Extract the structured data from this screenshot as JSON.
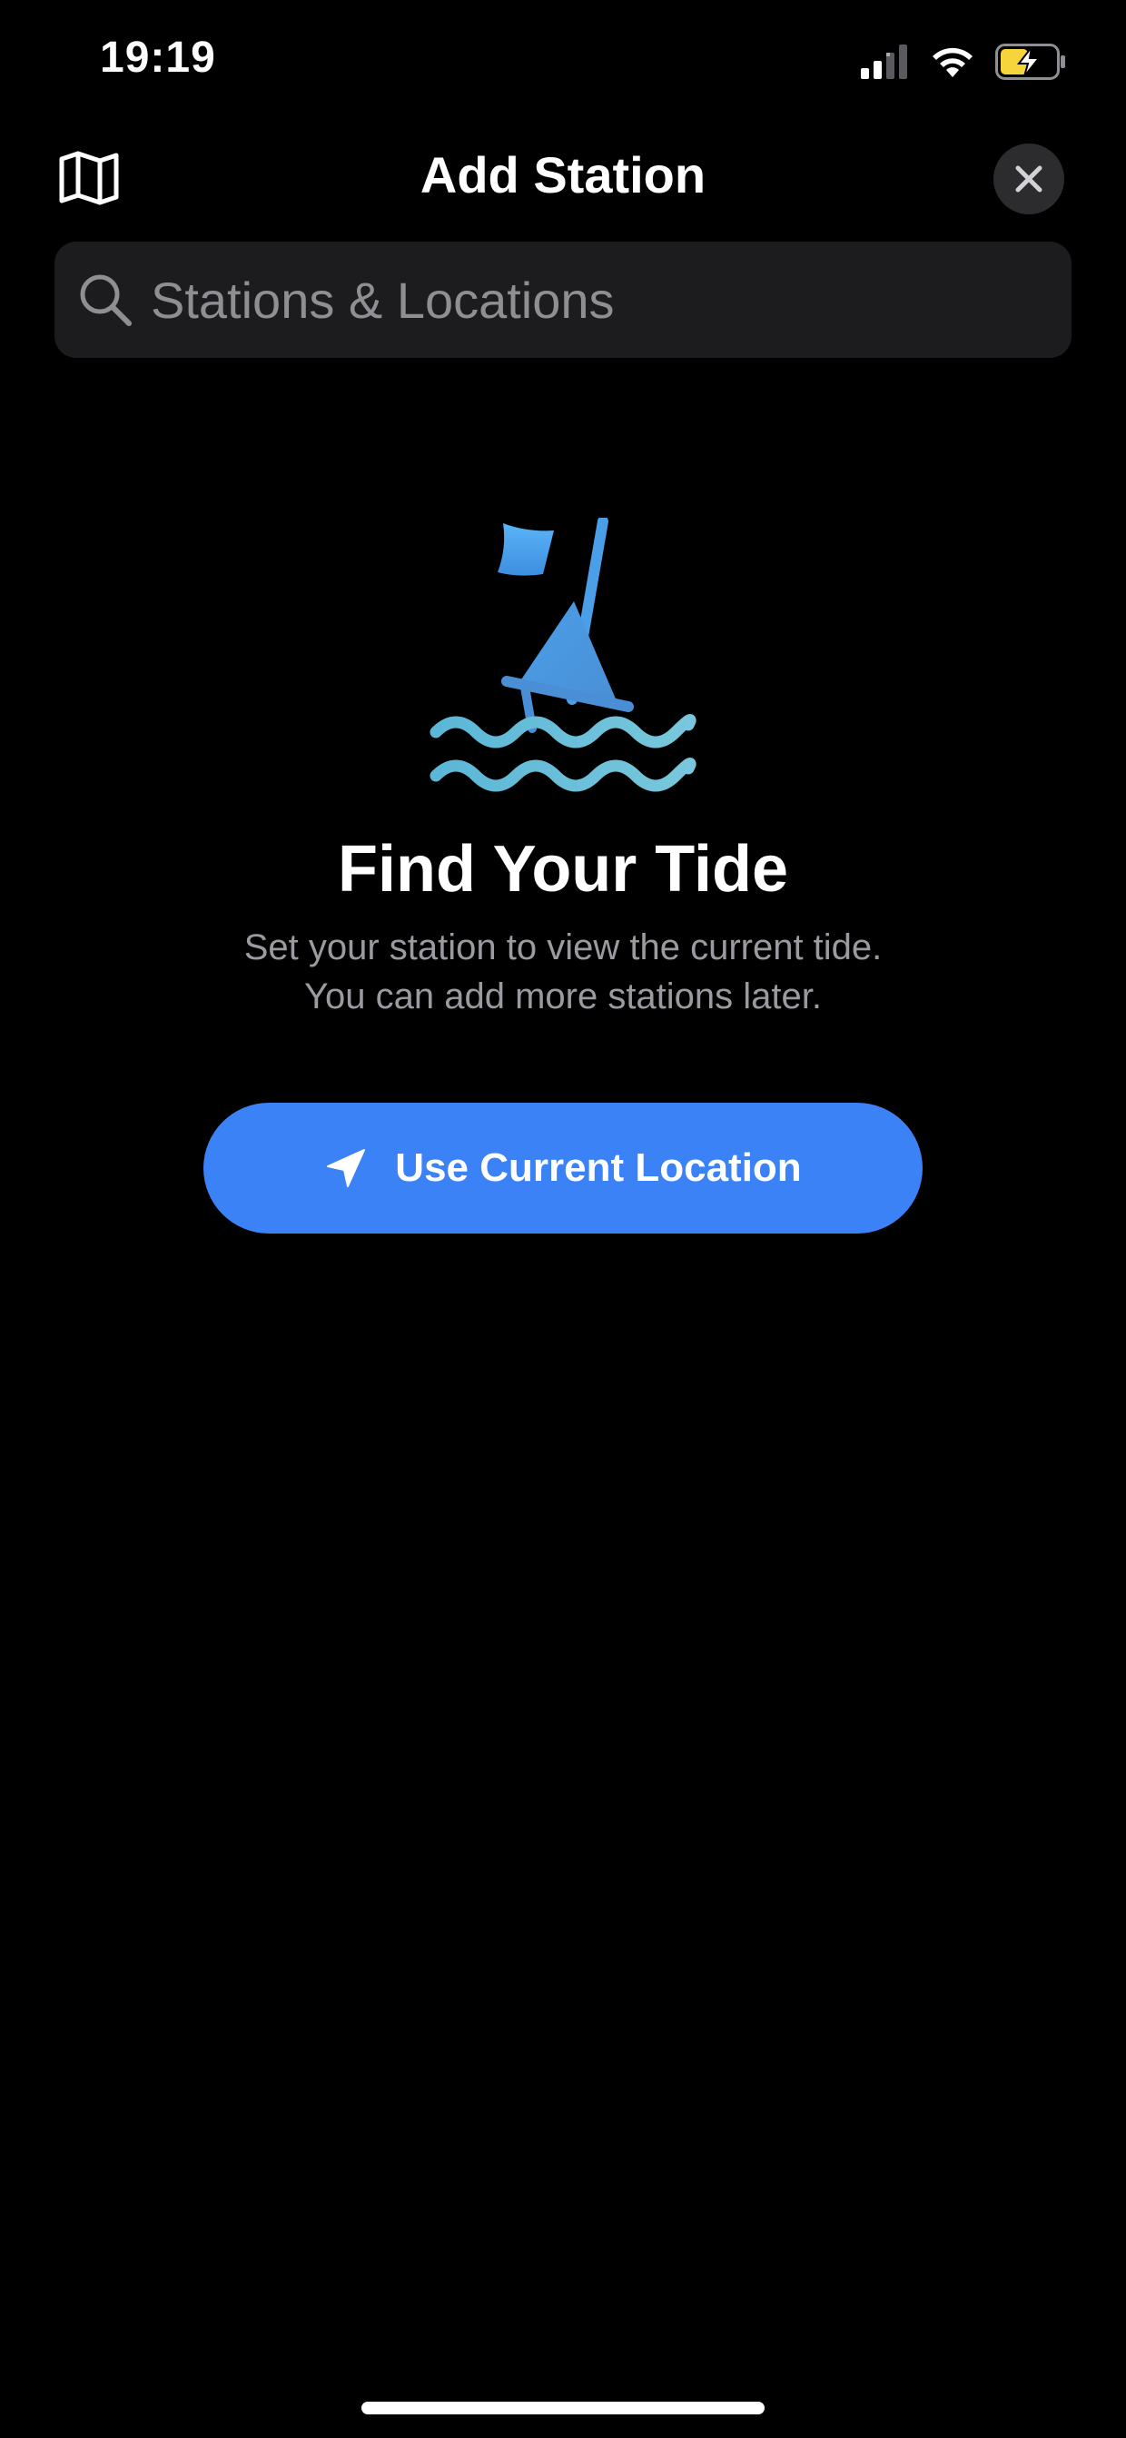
{
  "status_bar": {
    "time": "19:19",
    "icons": [
      "cellular-signal-icon",
      "wifi-icon",
      "battery-charging-icon"
    ],
    "battery_color": "#f5d43c"
  },
  "nav": {
    "title": "Add Station",
    "left_icon": "map-icon",
    "right_icon": "close-icon"
  },
  "search": {
    "placeholder": "Stations & Locations",
    "value": "",
    "icon": "search-icon"
  },
  "hero": {
    "icon": "buoy-waves-icon",
    "title": "Find Your Tide",
    "subtitle_lines": [
      "Set your station to view the current tide.",
      "You can add more stations later."
    ]
  },
  "cta": {
    "label": "Use Current Location",
    "icon": "location-arrow-icon",
    "color": "#3b82f6"
  },
  "colors": {
    "background": "#000000",
    "surface": "#1c1c1e",
    "secondary_text": "#9a9aa0",
    "accent_blue": "#3b82f6"
  }
}
